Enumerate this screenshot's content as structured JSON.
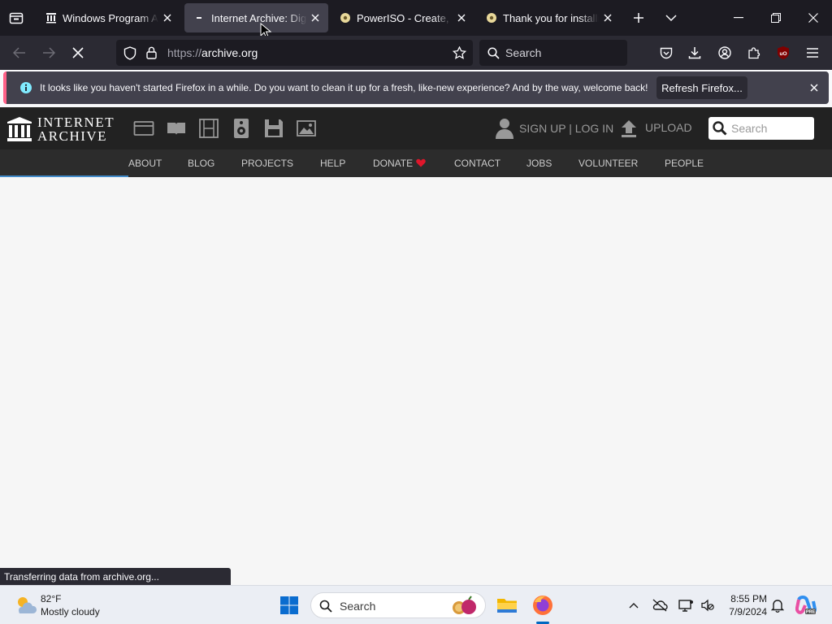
{
  "tabs": [
    {
      "title": "Windows Program Archive",
      "favicon": "archive-building-icon",
      "active": false
    },
    {
      "title": "Internet Archive: Digital Library",
      "favicon": "loading-icon",
      "active": true
    },
    {
      "title": "PowerISO - Create, Burn",
      "favicon": "poweriso-disc-icon",
      "active": false
    },
    {
      "title": "Thank you for installing",
      "favicon": "poweriso-disc-icon",
      "active": false
    }
  ],
  "nav": {
    "url_protocol": "https://",
    "url_host": "archive.org",
    "search_placeholder": "Search"
  },
  "notification": {
    "message": "It looks like you haven't started Firefox in a while. Do you want to clean it up for a fresh, like-new experience? And by the way, welcome back!",
    "button_label": "Refresh Firefox..."
  },
  "archive": {
    "logo_line1": "INTERNET",
    "logo_line2": "ARCHIVE",
    "user_links": "SIGN UP | LOG IN",
    "upload_label": "UPLOAD",
    "search_placeholder": "Search",
    "nav_items": [
      "ABOUT",
      "BLOG",
      "PROJECTS",
      "HELP",
      "DONATE",
      "CONTACT",
      "JOBS",
      "VOLUNTEER",
      "PEOPLE"
    ]
  },
  "status_text": "Transferring data from archive.org...",
  "taskbar": {
    "temperature": "82°F",
    "condition": "Mostly cloudy",
    "search_placeholder": "Search",
    "time": "8:55 PM",
    "date": "7/9/2024"
  },
  "colors": {
    "tabstrip_bg": "#1c1b22",
    "toolbar_bg": "#2b2a33",
    "archive_header_bg": "#222222",
    "donate_heart": "#e0162b",
    "progress_accent": "#428bca"
  }
}
